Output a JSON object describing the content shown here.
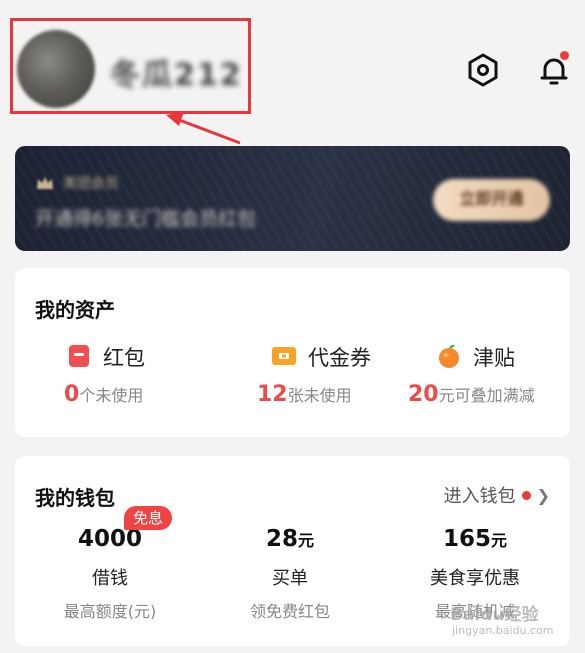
{
  "header": {
    "username": "冬瓜212",
    "icons": {
      "settings": "settings-hexagon-icon",
      "notifications": "bell-icon"
    }
  },
  "banner": {
    "title": "美团会员",
    "subtitle": "开通得6张无门槛会员红包",
    "button_label": "立即开通"
  },
  "assets": {
    "title": "我的资产",
    "items": [
      {
        "name": "红包",
        "count": "0",
        "suffix": "个未使用",
        "icon": "red-packet-icon"
      },
      {
        "name": "代金券",
        "count": "12",
        "suffix": "张未使用",
        "icon": "voucher-icon"
      },
      {
        "name": "津贴",
        "count": "20",
        "suffix": "元可叠加满减",
        "icon": "allowance-orange-icon"
      }
    ]
  },
  "wallet": {
    "title": "我的钱包",
    "link_label": "进入钱包",
    "badge": "免息",
    "items": [
      {
        "amount": "4000",
        "unit": "",
        "label": "借钱",
        "sub": "最高额度(元)"
      },
      {
        "amount": "28",
        "unit": "元",
        "label": "买单",
        "sub": "领免费红包"
      },
      {
        "amount": "165",
        "unit": "元",
        "label": "美食享优惠",
        "sub": "最高随机减"
      }
    ]
  },
  "watermark": {
    "text": "Baidu经验",
    "url": "jingyan.baidu.com"
  },
  "colors": {
    "accent_red": "#ef4a4a",
    "annotation_red": "#e8373b",
    "banner_bg": "#1c2233"
  }
}
